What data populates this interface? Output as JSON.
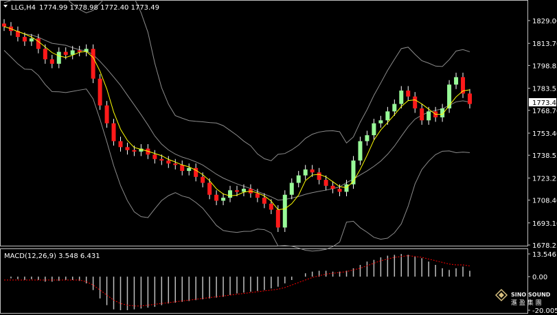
{
  "header": {
    "symbol_label": "LLG,H4",
    "ohlc": "1774.99 1778.98 1772.40 1773.49"
  },
  "colors": {
    "background": "#000000",
    "frame": "#c0c0c0",
    "up_candle": "#98fb98",
    "down_candle": "#ff1a1a",
    "wick": "#ffffff",
    "ma_line": "#ffff00",
    "bands": "#8c8c8c",
    "macd_hist": "#c0c0c0",
    "macd_signal": "#ff0000",
    "current_price_bg": "#ffffff",
    "current_price_text": "#000000"
  },
  "chart_data": [
    {
      "type": "line",
      "title": "LLG,H4 candlestick with Bollinger Bands and moving average",
      "y_axis_ticks": [
        "1829.00",
        "1813.70",
        "1798.85",
        "1783.55",
        "1768.70",
        "1753.40",
        "1738.55",
        "1723.25",
        "1708.40",
        "1693.10",
        "1678.25"
      ],
      "ylim": [
        1678.25,
        1829.0
      ],
      "current_price": "1773.49",
      "series": [
        {
          "name": "close",
          "values": [
            1825,
            1822,
            1818,
            1815,
            1817,
            1810,
            1803,
            1800,
            1808,
            1806,
            1809,
            1808,
            1810,
            1790,
            1772,
            1760,
            1748,
            1744,
            1742,
            1741,
            1743,
            1739,
            1736,
            1735,
            1733,
            1732,
            1728,
            1730,
            1724,
            1720,
            1712,
            1708,
            1710,
            1715,
            1714,
            1716,
            1713,
            1710,
            1706,
            1702,
            1690,
            1712,
            1720,
            1725,
            1729,
            1727,
            1722,
            1718,
            1716,
            1714,
            1719,
            1735,
            1748,
            1752,
            1760,
            1762,
            1768,
            1773,
            1782,
            1778,
            1770,
            1762,
            1768,
            1764,
            1770,
            1786,
            1791,
            1780,
            1773
          ]
        }
      ]
    },
    {
      "type": "bar",
      "title": "MACD(12,26,9) 3.548 6.431",
      "y_axis_ticks": [
        "13.546",
        "0.00",
        "-20.005"
      ],
      "ylim": [
        -20.005,
        13.546
      ],
      "series": [
        {
          "name": "MACD",
          "values": [
            0,
            -1,
            -1.5,
            -2,
            -1.5,
            -2,
            -3,
            -3,
            -2.5,
            -2,
            -2,
            -2.5,
            -4,
            -8,
            -13,
            -17,
            -19.5,
            -20,
            -20,
            -19.5,
            -19,
            -18.5,
            -18,
            -17,
            -16,
            -15.5,
            -15,
            -14.5,
            -14,
            -13.5,
            -13,
            -12.5,
            -12,
            -11,
            -10,
            -9.5,
            -9,
            -8.5,
            -8,
            -7,
            -6,
            -4,
            -2,
            0,
            2,
            3,
            3.5,
            3.5,
            3,
            3,
            3.5,
            5,
            7,
            9,
            10,
            11.5,
            12.5,
            13,
            13.5,
            13,
            12,
            11,
            9,
            7,
            5,
            4,
            5,
            6,
            3.5
          ]
        },
        {
          "name": "Signal",
          "values": [
            -2,
            -2,
            -2,
            -2,
            -2,
            -2,
            -2,
            -2,
            -2,
            -2,
            -2,
            -2,
            -3,
            -5,
            -8,
            -11,
            -14,
            -16,
            -17,
            -17.5,
            -17.5,
            -17,
            -16.5,
            -16,
            -15.5,
            -15,
            -14.5,
            -14,
            -13.5,
            -13,
            -12.5,
            -12,
            -11.5,
            -11,
            -10.5,
            -10,
            -9.5,
            -9,
            -8.5,
            -8,
            -7.5,
            -6.5,
            -5,
            -3.5,
            -2,
            -0.5,
            0.5,
            1.5,
            2,
            2.5,
            3,
            4,
            5,
            6.5,
            8,
            9.5,
            10.5,
            11.5,
            12,
            12.5,
            12,
            11.5,
            10.5,
            9.5,
            8.5,
            7.5,
            7,
            7,
            6.4
          ]
        }
      ]
    }
  ],
  "macd_label": "MACD(12,26,9) 3.548 6.431",
  "watermark": {
    "brand": "SINO SOUND",
    "sub": "滙 盈 集 團"
  }
}
